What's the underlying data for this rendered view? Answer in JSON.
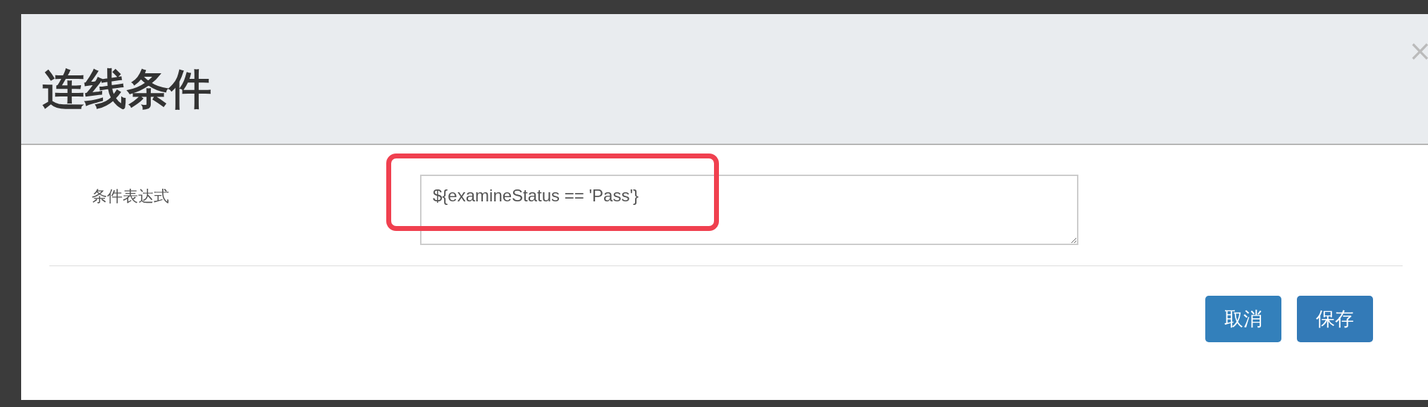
{
  "dialog": {
    "title": "连线条件",
    "close": "×"
  },
  "form": {
    "fields": [
      {
        "label": "条件表达式",
        "value": "${examineStatus == 'Pass'}"
      }
    ]
  },
  "buttons": [
    {
      "label": "取消",
      "kind": "cancel"
    },
    {
      "label": "保存",
      "kind": "save"
    }
  ]
}
